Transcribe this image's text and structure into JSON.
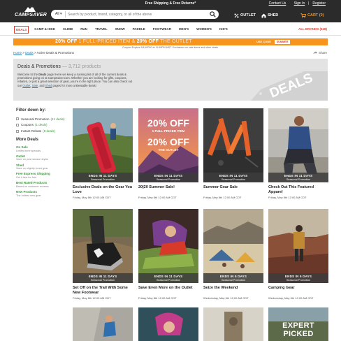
{
  "topbar": {
    "shipping": "Free Shipping & Free Returns*",
    "contact": "Contact Us",
    "sign_in": "Sign In",
    "sep": "|",
    "register": "Register"
  },
  "logo": {
    "text": "CAMPSAVER"
  },
  "search": {
    "category": "All",
    "placeholder": "Search by product, brand, category, or all of the above",
    "icon": "search-icon"
  },
  "header_links": {
    "outlet": "OUTLET",
    "shed": "SHED",
    "cart": "CART (0)"
  },
  "nav": {
    "items": [
      "DEALS",
      "CAMP & HIKE",
      "CLIMB",
      "RUN",
      "TRAVEL",
      "SNOW",
      "PADDLE",
      "FOOTWEAR",
      "MEN'S",
      "WOMEN'S",
      "KID'S"
    ],
    "all_brands": "ALL BRANDS (648)"
  },
  "banner": {
    "text_a": "20% OFF",
    "text_b": "1 FULL-PRICED ITEM",
    "text_c": "&",
    "text_d": "20% OFF",
    "text_e": "THE OUTLET",
    "code_label": "USE CODE",
    "code": "SUMMER",
    "sub": "Coupon Expires 5/19/2020 at 11:59PM MST. Exclusions on sale items and other deals."
  },
  "breadcrumb": {
    "home": "Home",
    "sep1": ">",
    "deals": "Deals",
    "sep2": ">",
    "current": "Active Deals & Promotions"
  },
  "share": {
    "label": "Share"
  },
  "hero": {
    "title": "Deals & Promotions",
    "count": "— 3,712 products",
    "body_1": "Welcome to the ",
    "body_bold": "Deals",
    "body_2": " page! Here we keep a running list of all of the current deals & promotions going on at CampSaver.com. Whether you are looking for gifts, coupons, rebates, or just a great selection of gear, you're in the right place. You can also check out our ",
    "link_outlet": "Outlet",
    "body_3": ", ",
    "link_sale": "Sale",
    "body_4": ", and ",
    "link_shed": "Shed",
    "body_5": " pages for more unbeatable deals!",
    "watermark": "DEALS"
  },
  "filter": {
    "title": "Filter down by:",
    "options": [
      {
        "label": "Seasonal Promotion",
        "count": "(41 deals)"
      },
      {
        "label": "Coupons",
        "count": "(1 deals)"
      },
      {
        "label": "Instant Rebate",
        "count": "(8 deals)"
      }
    ],
    "more_title": "More Deals",
    "more": [
      {
        "title": "On Sale",
        "sub": "Limited time specials"
      },
      {
        "title": "Outlet",
        "sub": "Save on past season styles"
      },
      {
        "title": "Shed",
        "sub": "Save on slightly-loved gear"
      },
      {
        "title": "Free Express Shipping",
        "sub": "Get it fast for free"
      },
      {
        "title": "Best Rated Products",
        "sub": "Based on customer reviews"
      },
      {
        "title": "New Products",
        "sub": "The hottest new gear"
      }
    ]
  },
  "cards": [
    {
      "ends": "ENDS IN 11 DAYS",
      "promo": "Seasonal Promotion",
      "title": "Exclusive Deals on the Gear You Love",
      "date": "Friday, May 8th 12:00 AM CDT"
    },
    {
      "ends": "ENDS IN 11 DAYS",
      "promo": "Seasonal Promotion",
      "title": "20|20 Summer Sale!",
      "date": "Friday, May 8th 12:00 AM CDT",
      "img_a": "20% OFF",
      "img_b": "1 FULL-PRICED ITEM",
      "img_c": "20% OFF",
      "img_d": "THE OUTLET"
    },
    {
      "ends": "ENDS IN 11 DAYS",
      "promo": "Seasonal Promotion",
      "title": "Summer Gear Sale",
      "date": "Friday, May 8th 12:00 AM CDT"
    },
    {
      "ends": "ENDS IN 11 DAYS",
      "promo": "Seasonal Promotion",
      "title": "Check Out This Featured Apparel",
      "date": "Friday, May 8th 12:00 AM CDT"
    },
    {
      "ends": "ENDS IN 11 DAYS",
      "promo": "Seasonal Promotion",
      "title": "Set Off on the Trail With Some New Footwear",
      "date": "Friday, May 8th 12:00 AM CDT"
    },
    {
      "ends": "ENDS IN 11 DAYS",
      "promo": "Seasonal Promotion",
      "title": "Save Even More on the Outlet",
      "date": "Friday, May 8th 12:00 AM CDT"
    },
    {
      "ends": "ENDS IN 5 DAYS",
      "promo": "Seasonal Promotion",
      "title": "Seize the Weekend",
      "date": "Wednesday, May 6th 12:00 AM CDT"
    },
    {
      "ends": "ENDS IN 5 DAYS",
      "promo": "Seasonal Promotion",
      "title": "Camping Gear",
      "date": "Wednesday, May 6th 12:00 AM CDT"
    }
  ],
  "bottom_thumb_text": {
    "line1": "EXPERT",
    "line2": "PICKED"
  },
  "colors": {
    "accent": "#f7941d",
    "nav_active": "#e03c31",
    "header": "#2b2b2b",
    "filter_green": "#3a9a3a"
  }
}
